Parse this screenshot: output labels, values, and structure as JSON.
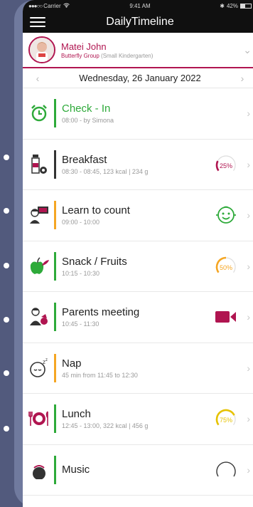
{
  "status": {
    "carrier": "Carrier",
    "time": "9:41 AM",
    "battery": "42%",
    "battery_level": 0.42
  },
  "nav": {
    "title": "DailyTimeline"
  },
  "child": {
    "name": "Matei John",
    "group": "Butterfly Group",
    "group_detail": "(Small Kindergarten)"
  },
  "date": {
    "label": "Wednesday, 26 January 2022"
  },
  "colors": {
    "brand": "#b01550",
    "green": "#2eaa3a",
    "orange": "#f5a623",
    "dark": "#333333",
    "gold": "#e6c200"
  },
  "timeline": [
    {
      "title": "Check - In",
      "subtitle": "08:00 - by Simona",
      "icon": "alarm-clock-icon",
      "bar_color": "#2eaa3a",
      "title_color": "#2eaa3a",
      "right": "none"
    },
    {
      "title": "Breakfast",
      "subtitle": "08:30 - 08:45, 123 kcal | 234 g",
      "icon": "milk-bottle-icon",
      "bar_color": "#333333",
      "right": "gauge",
      "gauge_label": "25%",
      "gauge_value": 0.25,
      "gauge_color": "#b01550"
    },
    {
      "title": "Learn to count",
      "subtitle": "09:00 - 10:00",
      "icon": "teacher-icon",
      "bar_color": "#f5a623",
      "right": "smiley",
      "mood_color": "#2eaa3a"
    },
    {
      "title": "Snack / Fruits",
      "subtitle": "10:15 - 10:30",
      "icon": "apple-icon",
      "bar_color": "#2eaa3a",
      "right": "gauge",
      "gauge_label": "50%",
      "gauge_value": 0.5,
      "gauge_color": "#f5a623"
    },
    {
      "title": "Parents meeting",
      "subtitle": "10:45 - 11:30",
      "icon": "parents-icon",
      "bar_color": "#2eaa3a",
      "right": "video",
      "video_color": "#b01550"
    },
    {
      "title": "Nap",
      "subtitle": "45 min from 11:45 to 12:30",
      "icon": "sleeping-baby-icon",
      "bar_color": "#f5a623",
      "right": "none"
    },
    {
      "title": "Lunch",
      "subtitle": "12:45 - 13:00, 322 kcal | 456 g",
      "icon": "plate-cutlery-icon",
      "bar_color": "#2eaa3a",
      "right": "gauge",
      "gauge_label": "75%",
      "gauge_value": 0.75,
      "gauge_color": "#e6c200"
    },
    {
      "title": "Music",
      "subtitle": "",
      "icon": "music-kid-icon",
      "bar_color": "#2eaa3a",
      "right": "gauge-partial"
    }
  ]
}
